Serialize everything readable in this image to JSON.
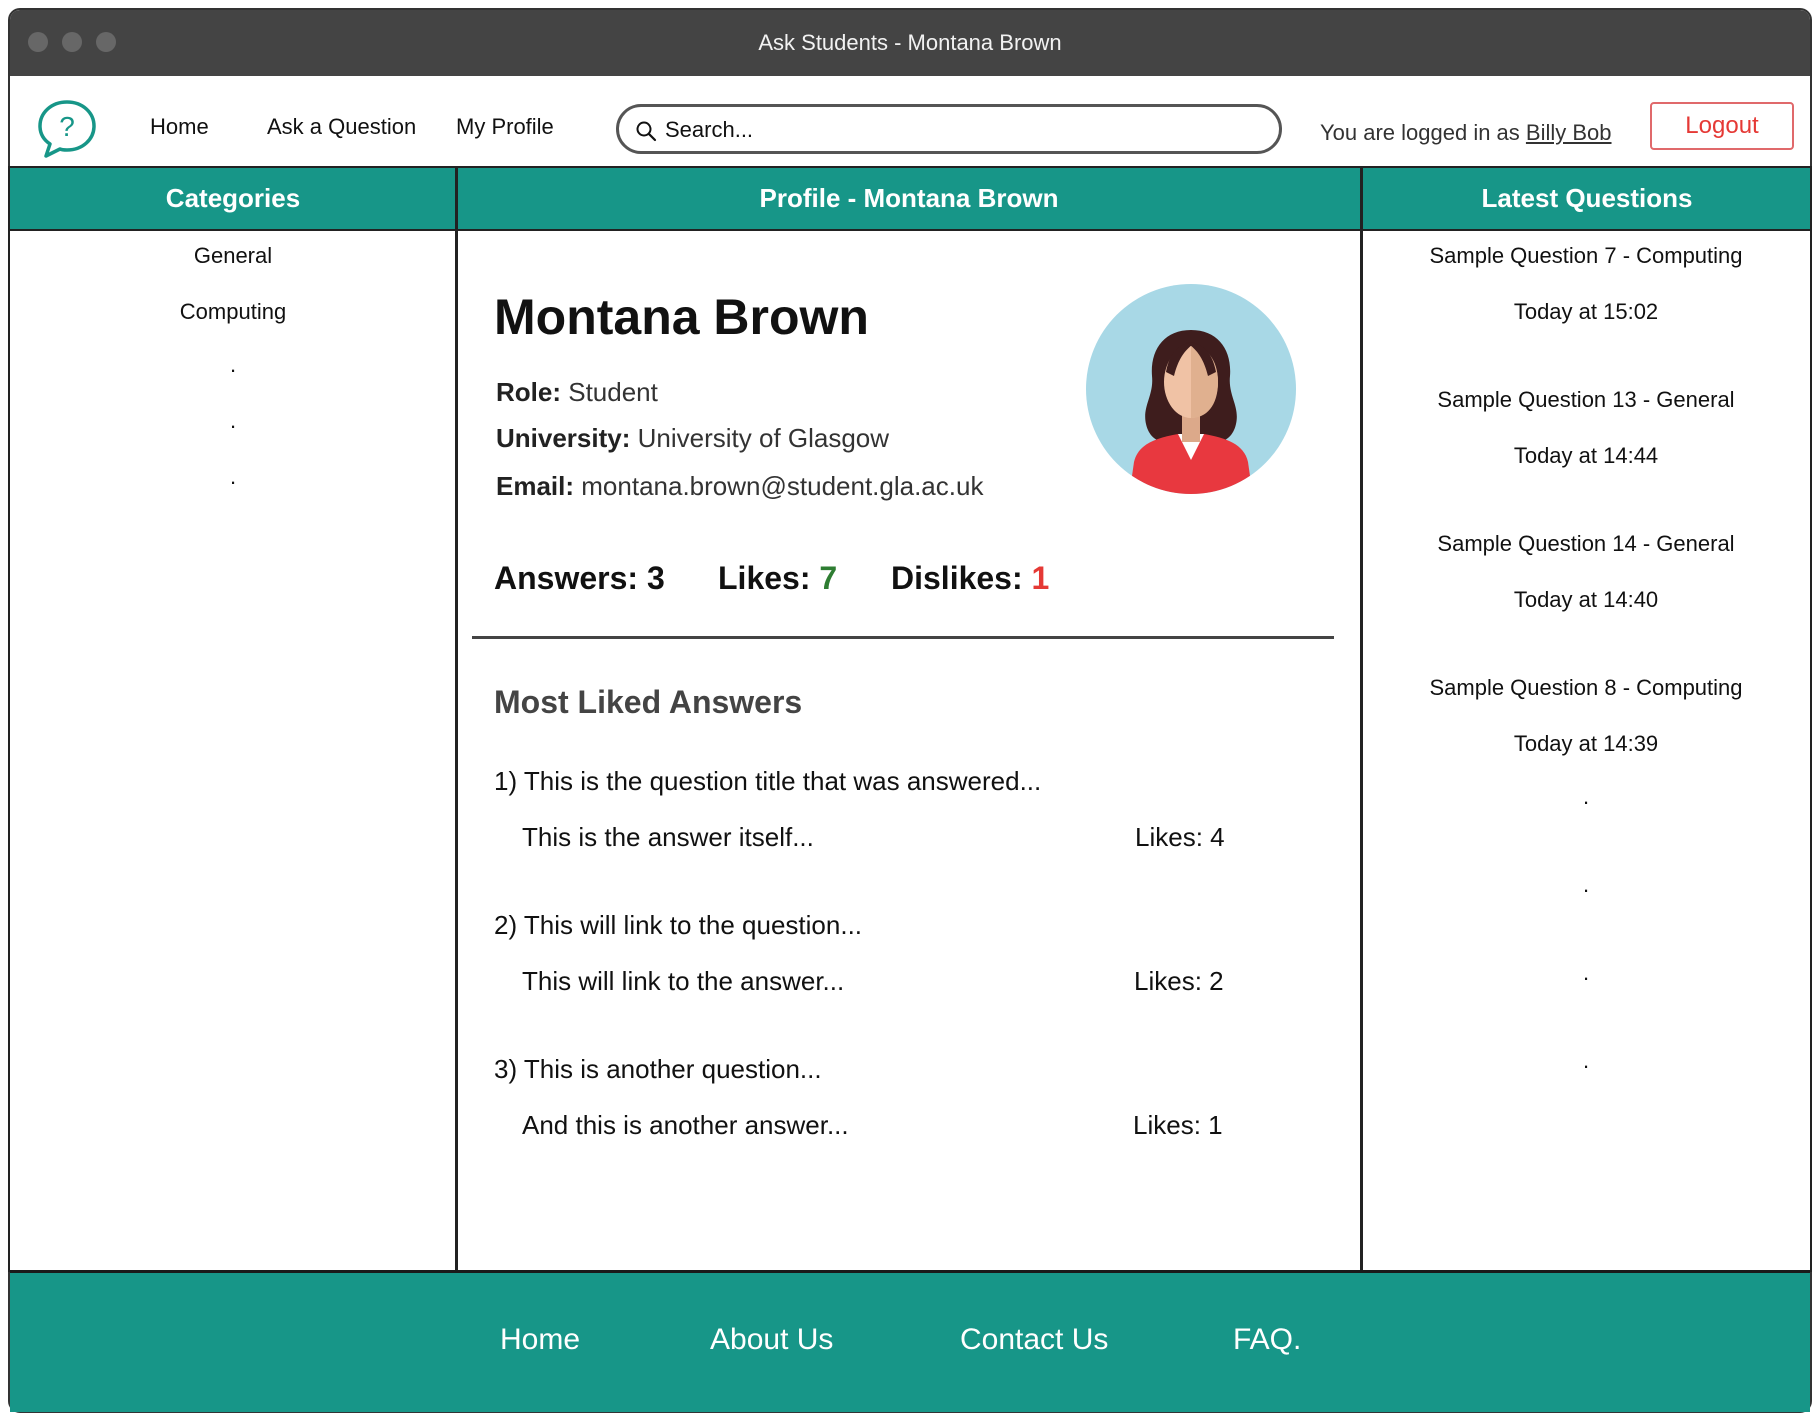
{
  "window": {
    "title": "Ask Students - Montana Brown"
  },
  "nav": {
    "home": "Home",
    "ask": "Ask a Question",
    "profile": "My Profile",
    "search_placeholder": "Search...",
    "logged_prefix": "You are logged in as",
    "logged_user": "Billy Bob",
    "logout": "Logout"
  },
  "categories": {
    "header": "Categories",
    "items": [
      "General",
      "Computing"
    ],
    "more": [
      ".",
      ".",
      "."
    ]
  },
  "profile": {
    "header": "Profile - Montana Brown",
    "name": "Montana Brown",
    "role_label": "Role:",
    "role": "Student",
    "university_label": "University:",
    "university": "University of Glasgow",
    "email_label": "Email:",
    "email": "montana.brown@student.gla.ac.uk",
    "answers_label": "Answers:",
    "answers": "3",
    "likes_label": "Likes:",
    "likes": "7",
    "dislikes_label": "Dislikes:",
    "dislikes": "1",
    "most_liked_title": "Most Liked Answers",
    "answers_list": [
      {
        "question": "1) This is the question title that was answered...",
        "answer": "This is the answer itself...",
        "likes": "Likes: 4"
      },
      {
        "question": "2) This will link to the question...",
        "answer": "This will link to the answer...",
        "likes": "Likes: 2"
      },
      {
        "question": "3) This is another question...",
        "answer": "And this is another answer...",
        "likes": "Likes: 1"
      }
    ]
  },
  "latest": {
    "header": "Latest Questions",
    "items": [
      {
        "title": "Sample Question 7 - Computing",
        "time": "Today at 15:02"
      },
      {
        "title": "Sample Question 13 - General",
        "time": "Today at 14:44"
      },
      {
        "title": "Sample Question 14 - General",
        "time": "Today at 14:40"
      },
      {
        "title": "Sample Question 8 - Computing",
        "time": "Today at 14:39"
      }
    ],
    "more": [
      ".",
      ".",
      ".",
      "."
    ]
  },
  "footer": {
    "home": "Home",
    "about": "About Us",
    "contact": "Contact Us",
    "faq": "FAQ."
  },
  "colors": {
    "teal": "#179688",
    "logout_red": "#e53935",
    "likes_green": "#2e7d32",
    "titlebar": "#444444"
  }
}
